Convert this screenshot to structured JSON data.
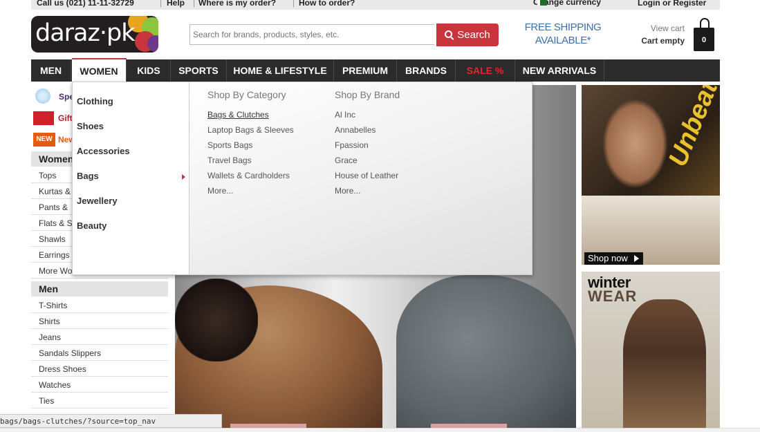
{
  "topbar": {
    "call_us": "Call us (021) 11-11-32729",
    "help": "Help",
    "where_order": "Where is my order?",
    "how_order": "How to order?",
    "change_currency": "Change currency",
    "login_register": "Login or Register"
  },
  "header": {
    "logo_text": "daraz·pk",
    "search_placeholder": "Search for brands, products, styles, etc.",
    "search_button": "Search",
    "shipping_line1": "FREE SHIPPING",
    "shipping_line2": "AVAILABLE*",
    "view_cart": "View cart",
    "cart_status": "Cart empty",
    "cart_count": "0"
  },
  "nav": {
    "items": [
      "MEN",
      "WOMEN",
      "KIDS",
      "SPORTS",
      "HOME & LIFESTYLE",
      "PREMIUM",
      "BRANDS",
      "SALE %",
      "NEW ARRIVALS"
    ],
    "active": "WOMEN"
  },
  "sidebar": {
    "promos": [
      "Spe",
      "Gift",
      "New"
    ],
    "new_badge": "NEW",
    "women_heading": "Women",
    "women_items": [
      "Tops",
      "Kurtas &",
      "Pants &",
      "Flats & S",
      "Shawls",
      "Earrings",
      "More Wo"
    ],
    "men_heading": "Men",
    "men_items": [
      "T-Shirts",
      "Shirts",
      "Jeans",
      "Sandals Slippers",
      "Dress Shoes",
      "Watches",
      "Ties"
    ]
  },
  "dropdown": {
    "categories": [
      "Clothing",
      "Shoes",
      "Accessories",
      "Bags",
      "Jewellery",
      "Beauty"
    ],
    "category_heading": "Shop By Category",
    "category_links": [
      "Bags & Clutches",
      "Laptop Bags & Sleeves",
      "Sports Bags",
      "Travel Bags",
      "Wallets & Cardholders",
      "More..."
    ],
    "brand_heading": "Shop By Brand",
    "brand_links": [
      "Al Inc",
      "Annabelles",
      "Fpassion",
      "Grace",
      "House of Leather",
      "More..."
    ]
  },
  "banners": {
    "banner1_script": "Unbeatable!",
    "shop_now": "Shop now",
    "winter_line1": "winter",
    "winter_line2": "WEAR"
  },
  "statusbar": {
    "url": "bags/bags-clutches/?source=top_nav"
  },
  "colors": {
    "brand_red": "#c9353c",
    "nav_bg": "#2b2b2b",
    "sale": "#e8242c",
    "shipping_blue": "#3a6fa8"
  }
}
